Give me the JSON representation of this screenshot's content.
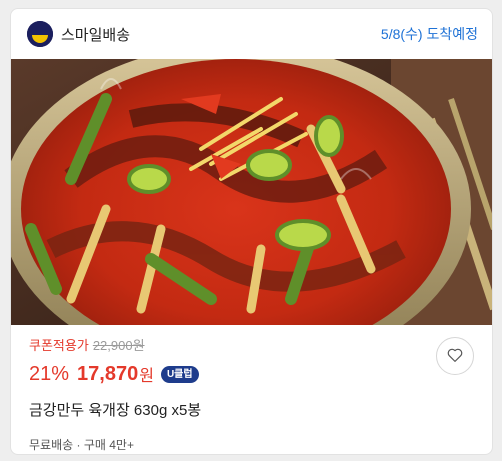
{
  "header": {
    "brand_name": "스마일배송",
    "delivery": "5/8(수) 도착예정"
  },
  "product": {
    "coupon_label": "쿠폰적용가",
    "original_price": "22,900원",
    "discount": "21%",
    "price": "17,870",
    "price_unit": "원",
    "badge": "U클럽",
    "title": "금강만두 육개장 630g x5봉",
    "meta": "무료배송 · 구매 4만+"
  },
  "icons": {
    "logo": "smile-logo-icon",
    "wish": "heart-icon"
  },
  "colors": {
    "accent": "#e4392b",
    "delivery": "#1f72d6",
    "badge": "#1e3c8c"
  }
}
